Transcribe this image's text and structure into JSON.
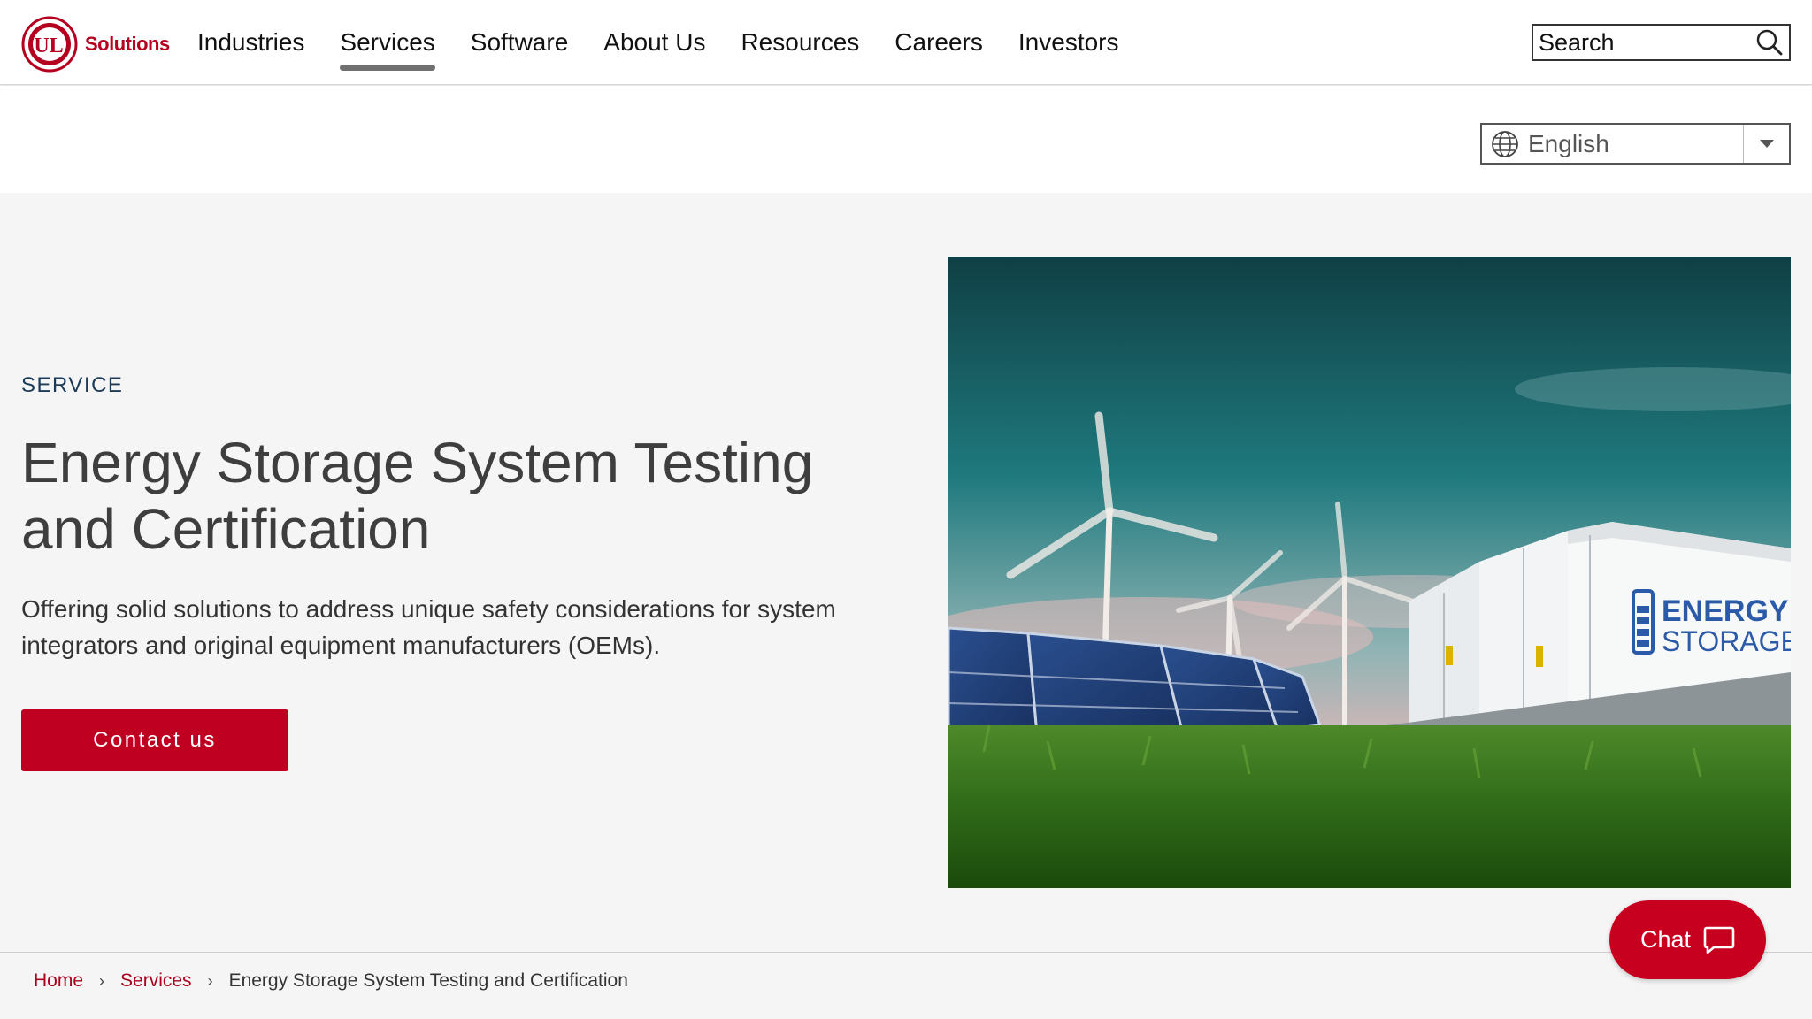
{
  "header": {
    "logo_mark": "UL",
    "logo_text": "Solutions",
    "nav": [
      {
        "label": "Industries"
      },
      {
        "label": "Services"
      },
      {
        "label": "Software"
      },
      {
        "label": "About Us"
      },
      {
        "label": "Resources"
      },
      {
        "label": "Careers"
      },
      {
        "label": "Investors"
      }
    ],
    "active_nav": "Services",
    "search_placeholder": "Search"
  },
  "language": {
    "selected": "English"
  },
  "hero": {
    "eyebrow": "SERVICE",
    "title": "Energy Storage System Testing and Certification",
    "description": "Offering solid solutions to address unique safety considerations for system integrators and original equipment manufacturers (OEMs).",
    "cta_label": "Contact us",
    "image_text_line1": "ENERGY",
    "image_text_line2": "STORAGE"
  },
  "breadcrumb": {
    "items": [
      {
        "label": "Home"
      },
      {
        "label": "Services"
      }
    ],
    "current": "Energy Storage System Testing and Certification"
  },
  "chat": {
    "label": "Chat"
  },
  "colors": {
    "brand_red": "#c00020",
    "link_red": "#a8001d",
    "eyebrow_navy": "#1b3a57",
    "hero_bg": "#f5f5f5"
  }
}
